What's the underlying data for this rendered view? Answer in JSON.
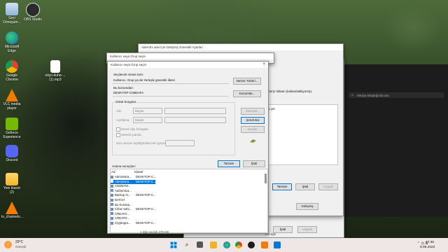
{
  "desktop_icons": [
    {
      "label": "Geri Dönüşüm...",
      "icon": "recycle-bin-icon"
    },
    {
      "label": "OBS Studio",
      "icon": "obs-icon"
    },
    {
      "label": "Microsoft Edge",
      "icon": "edge-icon"
    },
    {
      "label": "Google Chrome",
      "icon": "chrome-icon"
    },
    {
      "label": "eliyo-duhe-...(1).mp3",
      "icon": "mp3-file-icon"
    },
    {
      "label": "VLC media player",
      "icon": "vlc-icon"
    },
    {
      "label": "Geforce Experience",
      "icon": "geforce-icon"
    },
    {
      "label": "Discord",
      "icon": "discord-icon"
    },
    {
      "label": "Yeni klasör (2)",
      "icon": "folder-icon"
    },
    {
      "label": "tv_channels...",
      "icon": "vlc-playlist-icon"
    }
  ],
  "security_window": {
    "title": "Alarm01.wav İçin Gelişmiş Güvenlik Ayarları",
    "snippet_1": "nie'yi tıklatın (kullanılabiliyorsa).",
    "snippet_2": "ndiği yer",
    "ok": "Tamam",
    "cancel": "İptal",
    "apply": "Uygula",
    "advanced": "Gelişmiş"
  },
  "select_group_back": {
    "title": "Kullanıcı veya Grup seçin"
  },
  "select_dialog": {
    "title": "Kullanıcı veya Grup seçin",
    "object_type_label": "Seçilecek nesne türü:",
    "object_type_value": "Kullanıcı, Grup ya da Yerleşik güvenlik ilkesi",
    "object_types_button": "Nesne Türleri...",
    "location_label": "Bu konumdan:",
    "location_value": "DESKTOP-C09DHFA",
    "locations_button": "Konumlar...",
    "common_queries": "Ortak Sorgular",
    "name_label": "Adı:",
    "name_mode": "Başlar",
    "desc_label": "Açıklama:",
    "desc_mode": "Başlar",
    "disabled_accounts": "Devre dışı hesaplar",
    "no_expire_password": "Süresiz parola",
    "days_since_login": "Son oturum açıldığından beri geçen gün sayısı:",
    "columns_button": "Sütunlar...",
    "find_now_button": "Şimdi Bul",
    "stop_button": "Durdur",
    "ok_button": "Tamam",
    "cancel_button": "İptal",
    "results_label": "Arama sonuçları:",
    "col_name": "Ad",
    "col_folder": "Klasör",
    "rows": [
      {
        "name": "Administra...",
        "folder": "DESKTOP-C..."
      },
      {
        "name": "Administra...",
        "folder": "DESKTOP-C..."
      },
      {
        "name": "ANONYM...",
        "folder": ""
      },
      {
        "name": "Authentica...",
        "folder": ""
      },
      {
        "name": "Backup O...",
        "folder": "DESKTOP-C..."
      },
      {
        "name": "BATCH",
        "folder": ""
      },
      {
        "name": "Bu Kuruluş...",
        "folder": ""
      },
      {
        "name": "Cihaz Sahi...",
        "folder": "DESKTOP-C..."
      },
      {
        "name": "CREATO...",
        "folder": ""
      },
      {
        "name": "CREATO...",
        "folder": ""
      },
      {
        "name": "Cryptogra...",
        "folder": "DESKTOP-C..."
      }
    ]
  },
  "properties_window": {
    "ok": "Tamam",
    "cancel": "İptal",
    "apply": "Uygula",
    "status_items": "100 öğe",
    "status_selection": "1 öğe seçildi  479 KB"
  },
  "black_panel": {
    "search_placeholder": "Medya kitaplığında ara"
  },
  "taskbar": {
    "weather_temp": "29°C",
    "weather_desc": "Güneşli",
    "clock_time": "17:36",
    "clock_date": "9.06.2022",
    "icons": [
      "windows-start-icon",
      "search-icon",
      "task-view-icon",
      "folder-icon",
      "edge-icon",
      "chrome-icon",
      "xbox-icon",
      "discord-icon",
      "vlc-icon",
      "obs-icon",
      "store-icon",
      "photos-icon",
      "media-player-icon"
    ]
  },
  "colors": {
    "accent": "#0078d7",
    "taskbar_bg": "#efe6e6",
    "selection": "#0078d7"
  }
}
